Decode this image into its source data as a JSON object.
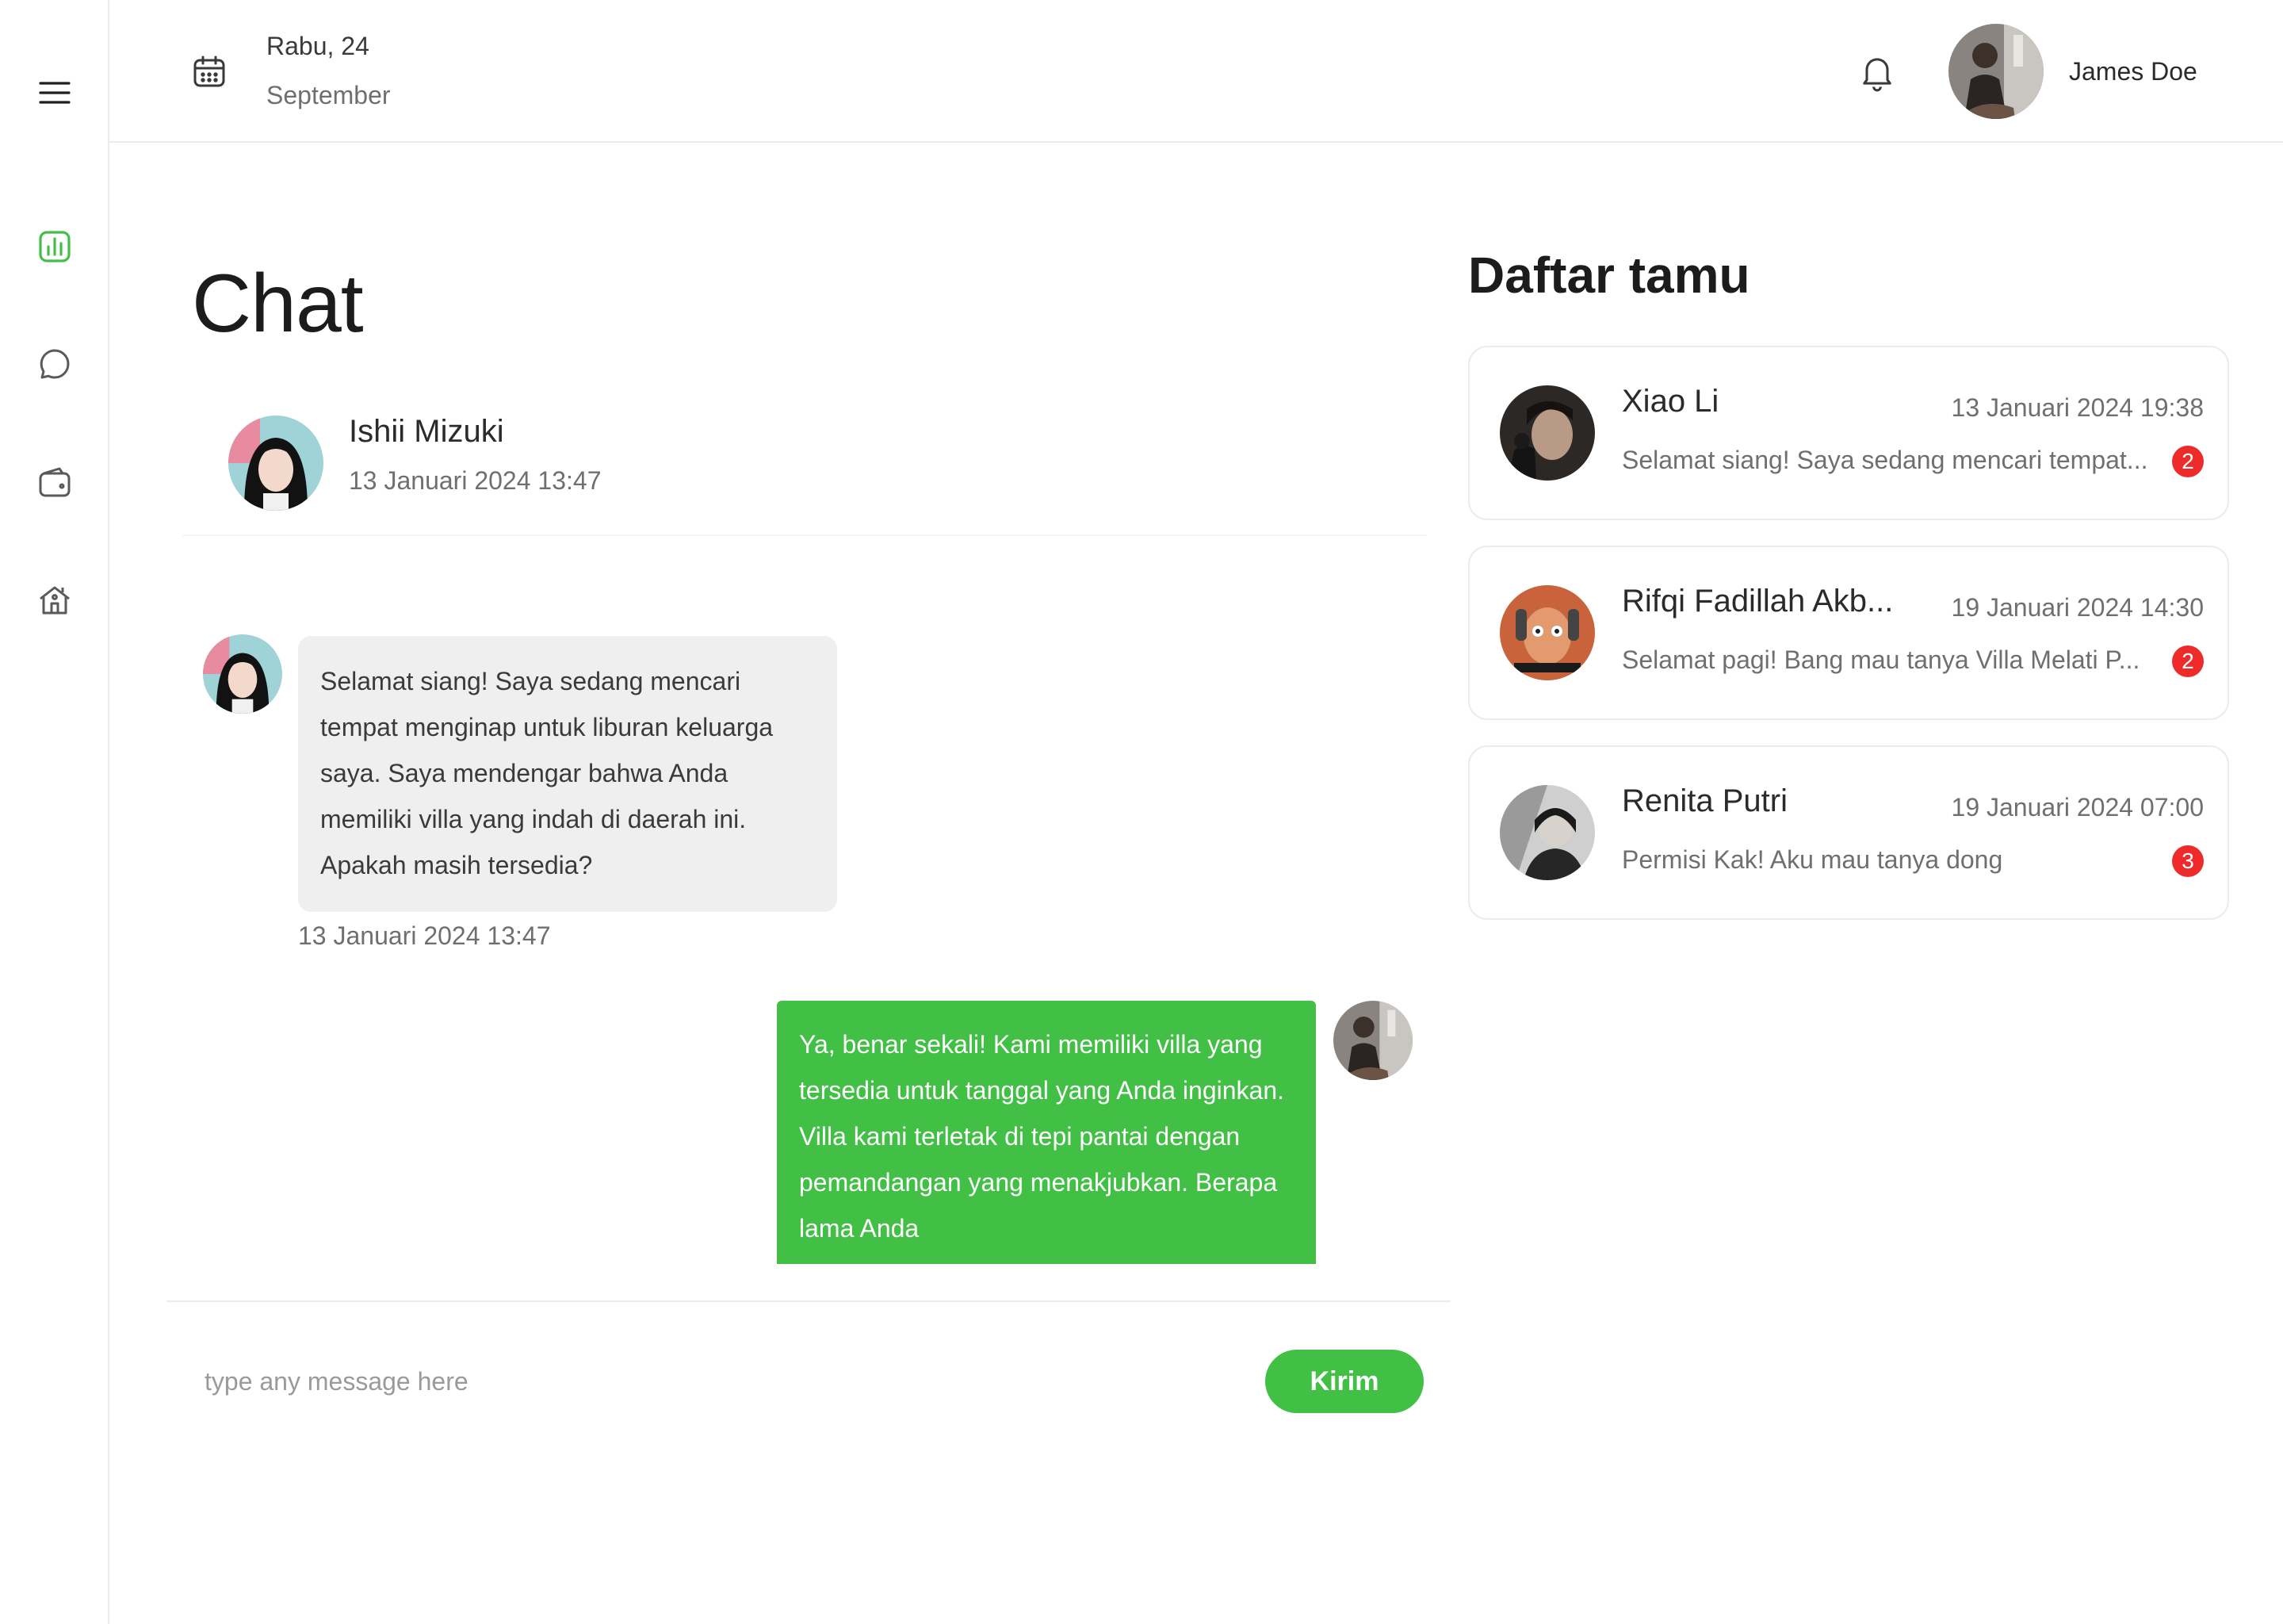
{
  "header": {
    "date_day": "Rabu, 24",
    "date_month": "September",
    "user_name": "James Doe"
  },
  "sidebar": {
    "items": [
      {
        "icon": "menu-icon"
      },
      {
        "icon": "chart-icon",
        "active": true
      },
      {
        "icon": "chat-icon"
      },
      {
        "icon": "wallet-icon"
      },
      {
        "icon": "house-icon"
      }
    ]
  },
  "chat": {
    "title": "Chat",
    "contact": {
      "name": "Ishii Mizuki",
      "time": "13 Januari 2024 13:47"
    },
    "messages": [
      {
        "direction": "incoming",
        "text": "Selamat siang! Saya sedang mencari tempat menginap untuk liburan keluarga saya. Saya mendengar bahwa Anda memiliki villa yang indah di daerah ini. Apakah masih tersedia?",
        "time": "13 Januari 2024 13:47"
      },
      {
        "direction": "outgoing",
        "text": "Ya, benar sekali! Kami memiliki villa yang tersedia untuk tanggal yang Anda inginkan. Villa kami terletak di tepi pantai dengan pemandangan yang menakjubkan. Berapa lama Anda"
      }
    ],
    "input_placeholder": "type any message here",
    "send_label": "Kirim"
  },
  "guests": {
    "title": "Daftar tamu",
    "items": [
      {
        "name": "Xiao Li",
        "time": "13 Januari 2024 19:38",
        "preview": "Selamat siang! Saya sedang mencari tempat...",
        "unread": "2"
      },
      {
        "name": "Rifqi Fadillah Akb...",
        "time": "19 Januari 2024 14:30",
        "preview": "Selamat pagi! Bang mau tanya Villa Melati P...",
        "unread": "2"
      },
      {
        "name": "Renita Putri",
        "time": "19 Januari 2024 07:00",
        "preview": "Permisi Kak! Aku mau tanya dong",
        "unread": "3"
      }
    ]
  },
  "colors": {
    "accent": "#42bf45",
    "badge": "#ee2b2b",
    "bubble_incoming": "#efefef"
  }
}
